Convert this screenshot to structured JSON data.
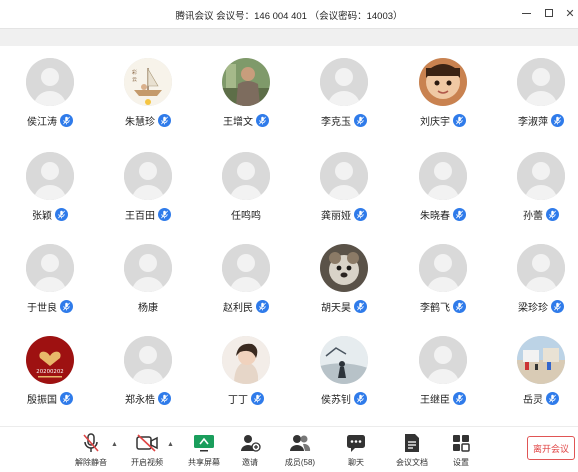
{
  "window": {
    "title": "腾讯会议 会议号：146 004 401 （会议密码：14003）"
  },
  "colors": {
    "accent": "#2f7bea",
    "leave": "#e04444",
    "avatar_default": "#d9d9d9"
  },
  "participants": [
    {
      "name": "侯江涛",
      "mic": "on",
      "avatar": "default"
    },
    {
      "name": "朱慧珍",
      "mic": "on",
      "avatar": "boat-illustration"
    },
    {
      "name": "王增文",
      "mic": "on",
      "avatar": "photo-person-outdoors"
    },
    {
      "name": "李克玉",
      "mic": "on",
      "avatar": "default"
    },
    {
      "name": "刘庆宇",
      "mic": "on",
      "avatar": "photo-child"
    },
    {
      "name": "李淑萍",
      "mic": "on",
      "avatar": "default"
    },
    {
      "name": "张颖",
      "mic": "on",
      "avatar": "default"
    },
    {
      "name": "王百田",
      "mic": "on",
      "avatar": "default"
    },
    {
      "name": "任鸣鸣",
      "mic": "none",
      "avatar": "default"
    },
    {
      "name": "龚丽娅",
      "mic": "on",
      "avatar": "default"
    },
    {
      "name": "朱晓春",
      "mic": "on",
      "avatar": "default"
    },
    {
      "name": "孙蕾",
      "mic": "on",
      "avatar": "default"
    },
    {
      "name": "于世良",
      "mic": "on",
      "avatar": "default"
    },
    {
      "name": "杨康",
      "mic": "none",
      "avatar": "default"
    },
    {
      "name": "赵利民",
      "mic": "on",
      "avatar": "default"
    },
    {
      "name": "胡天昊",
      "mic": "on",
      "avatar": "photo-dog"
    },
    {
      "name": "李鹤飞",
      "mic": "on",
      "avatar": "default"
    },
    {
      "name": "梁珍珍",
      "mic": "on",
      "avatar": "default"
    },
    {
      "name": "殷振国",
      "mic": "on",
      "avatar": "red-heart-card"
    },
    {
      "name": "郑永梏",
      "mic": "on",
      "avatar": "default"
    },
    {
      "name": "丁丁",
      "mic": "on",
      "avatar": "photo-portrait"
    },
    {
      "name": "侯苏钊",
      "mic": "on",
      "avatar": "photo-silhouette"
    },
    {
      "name": "王继臣",
      "mic": "on",
      "avatar": "default"
    },
    {
      "name": "岳灵",
      "mic": "on",
      "avatar": "photo-street"
    }
  ],
  "avatar_texts": {
    "red_heart_card": "20200202"
  },
  "toolbar": {
    "unmute": "解除静音",
    "start_video": "开启视频",
    "share_screen": "共享屏幕",
    "invite": "邀请",
    "members": "成员(58)",
    "chat": "聊天",
    "docs": "会议文档",
    "settings": "设置",
    "leave": "离开会议"
  }
}
